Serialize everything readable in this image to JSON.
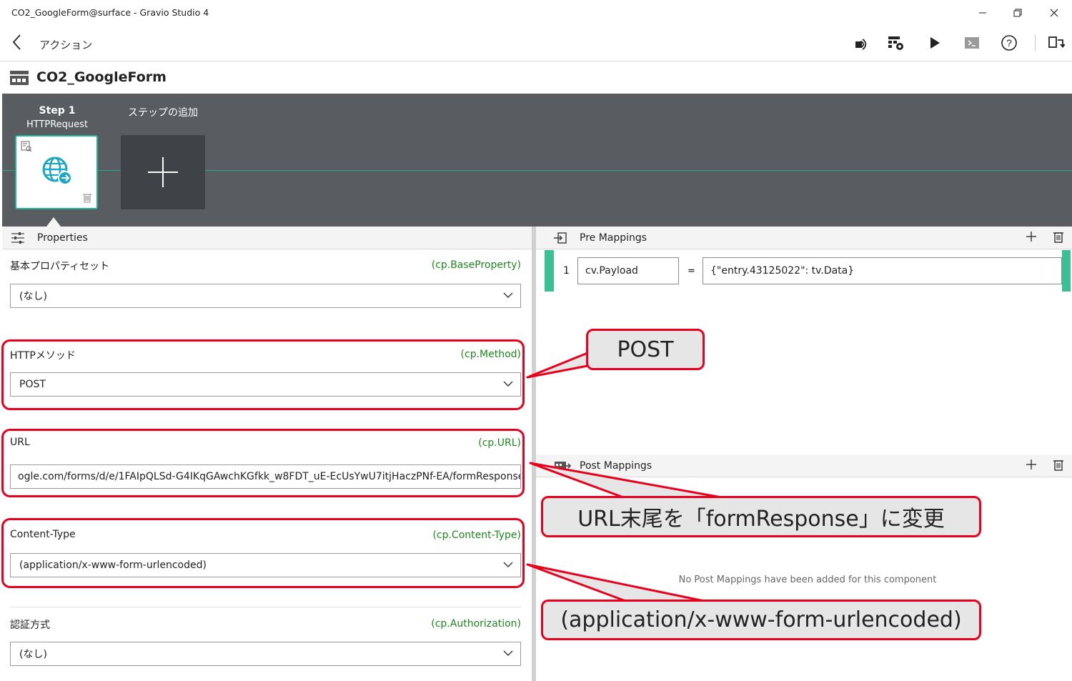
{
  "window": {
    "title": "CO2_GoogleForm@surface - Gravio Studio 4",
    "minimize_icon": "minimize-icon",
    "restore_icon": "restore-icon",
    "close_icon": "close-icon"
  },
  "nav": {
    "back_icon": "chevron-left-icon",
    "label": "アクション",
    "tools": [
      "broadcast-icon",
      "settings-grid-icon",
      "play-icon",
      "terminal-icon",
      "help-icon",
      "sync-icon"
    ]
  },
  "header": {
    "title": "CO2_GoogleForm"
  },
  "canvas": {
    "step1_title": "Step 1",
    "step1_sub": "HTTPRequest",
    "add_step_title": "ステップの追加"
  },
  "properties": {
    "section_title": "Properties",
    "base": {
      "label": "基本プロパティセット",
      "key": "(cp.BaseProperty)",
      "value": "(なし)"
    },
    "method": {
      "label": "HTTPメソッド",
      "key": "(cp.Method)",
      "value": "POST"
    },
    "url": {
      "label": "URL",
      "key": "(cp.URL)",
      "value": "ogle.com/forms/d/e/1FAIpQLSd-G4IKqGAwchKGfkk_w8FDT_uE-EcUsYwU7itjHaczPNf-EA/formResponse"
    },
    "content_type": {
      "label": "Content-Type",
      "key": "(cp.Content-Type)",
      "value": "(application/x-www-form-urlencoded)"
    },
    "auth": {
      "label": "認証方式",
      "key": "(cp.Authorization)",
      "value": "(なし)"
    }
  },
  "pre_mappings": {
    "section_title": "Pre Mappings",
    "rows": [
      {
        "index": "1",
        "target": "cv.Payload",
        "op": "=",
        "expr": "{\"entry.43125022\": tv.Data}"
      }
    ]
  },
  "post_mappings": {
    "section_title": "Post Mappings",
    "empty_text": "No Post Mappings have been added for this component"
  },
  "callouts": {
    "method": "POST",
    "url": "URL末尾を「formResponse」に変更",
    "content_type": "(application/x-www-form-urlencoded)"
  },
  "colors": {
    "accent": "#23b39a",
    "canvas_bg": "#595c60",
    "highlight_red": "#e8001c",
    "key_green": "#1e8a1e"
  }
}
